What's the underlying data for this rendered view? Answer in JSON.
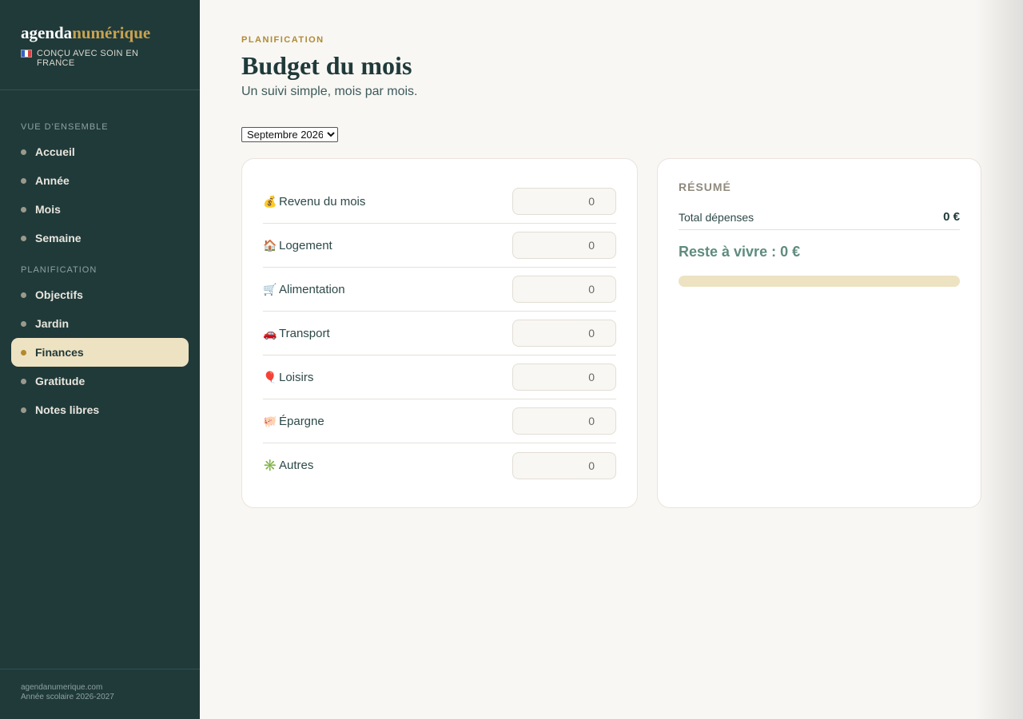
{
  "brand": {
    "logo_part1": "agenda",
    "logo_part2": "numérique",
    "tagline": "CONÇU AVEC SOIN EN FRANCE"
  },
  "sidebar": {
    "section1": "VUE D'ENSEMBLE",
    "section2": "PLANIFICATION",
    "items": [
      {
        "label": "Accueil"
      },
      {
        "label": "Année"
      },
      {
        "label": "Mois"
      },
      {
        "label": "Semaine"
      },
      {
        "label": "Objectifs"
      },
      {
        "label": "Jardin"
      },
      {
        "label": "Finances"
      },
      {
        "label": "Gratitude"
      },
      {
        "label": "Notes libres"
      }
    ],
    "active": "Finances",
    "footer_line1": "agendanumerique.com",
    "footer_line2": "Année scolaire 2026-2027"
  },
  "header": {
    "eyebrow": "PLANIFICATION",
    "title": "Budget du mois",
    "subtitle": "Un suivi simple, mois par mois."
  },
  "month_select": {
    "selected": "Septembre 2026"
  },
  "budget": {
    "rows": [
      {
        "emoji": "💰",
        "label": "Revenu du mois",
        "value": "0"
      },
      {
        "emoji": "🏠",
        "label": "Logement",
        "value": "0"
      },
      {
        "emoji": "🛒",
        "label": "Alimentation",
        "value": "0"
      },
      {
        "emoji": "🚗",
        "label": "Transport",
        "value": "0"
      },
      {
        "emoji": "🎈",
        "label": "Loisirs",
        "value": "0"
      },
      {
        "emoji": "🐖",
        "label": "Épargne",
        "value": "0"
      },
      {
        "emoji": "✳️",
        "label": "Autres",
        "value": "0"
      }
    ]
  },
  "summary": {
    "title": "RÉSUMÉ",
    "total_label": "Total dépenses",
    "total_value": "0 €",
    "reste": "Reste à vivre : 0 €",
    "progress_fraction": 0
  },
  "colors": {
    "sidebar_bg": "#203a3a",
    "accent_gold": "#c9a24f",
    "active_bg": "#ede2c2",
    "positive_green": "#5e8c7e"
  }
}
